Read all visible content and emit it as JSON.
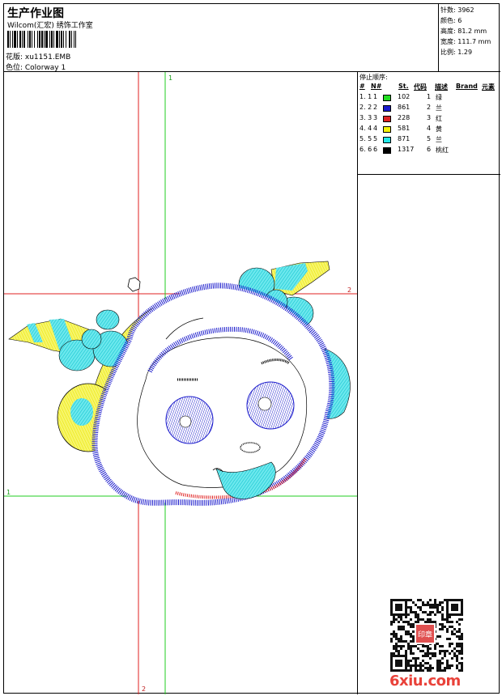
{
  "header": {
    "title": "生产作业图",
    "studio": "Wilcom(汇宏) 绣饰工作室",
    "design_label": "花版: xu1151.EMB",
    "colorway_label": "色位: Colorway 1"
  },
  "stats": {
    "stitches": "针数: 3962",
    "colors": "颜色: 6",
    "height": "高度: 81.2 mm",
    "width": "宽度: 111.7 mm",
    "scale": "比例: 1.29"
  },
  "stop_sequence": {
    "title": "停止顺序:",
    "headers": [
      "#",
      "N#",
      "St.",
      "代码",
      "描述",
      "Brand",
      "元素"
    ],
    "rows": [
      {
        "idx": "1. 1",
        "n": "1",
        "color": "#22dd22",
        "st": "102",
        "code": "1",
        "desc": "绿"
      },
      {
        "idx": "2. 2",
        "n": "2",
        "color": "#1a1acc",
        "st": "861",
        "code": "2",
        "desc": "兰"
      },
      {
        "idx": "3. 3",
        "n": "3",
        "color": "#dd2222",
        "st": "228",
        "code": "3",
        "desc": "红"
      },
      {
        "idx": "4. 4",
        "n": "4",
        "color": "#f2f20a",
        "st": "581",
        "code": "4",
        "desc": "黄"
      },
      {
        "idx": "5. 5",
        "n": "5",
        "color": "#22e8e8",
        "st": "871",
        "code": "5",
        "desc": "兰"
      },
      {
        "idx": "6. 6",
        "n": "6",
        "color": "#000000",
        "st": "1317",
        "code": "6",
        "desc": "桃红"
      }
    ]
  },
  "guides": {
    "green_h": "1",
    "green_v": "1",
    "red_h": "2",
    "red_v": "2"
  },
  "watermark": {
    "site": "6xiu.com",
    "seal": "印章"
  }
}
